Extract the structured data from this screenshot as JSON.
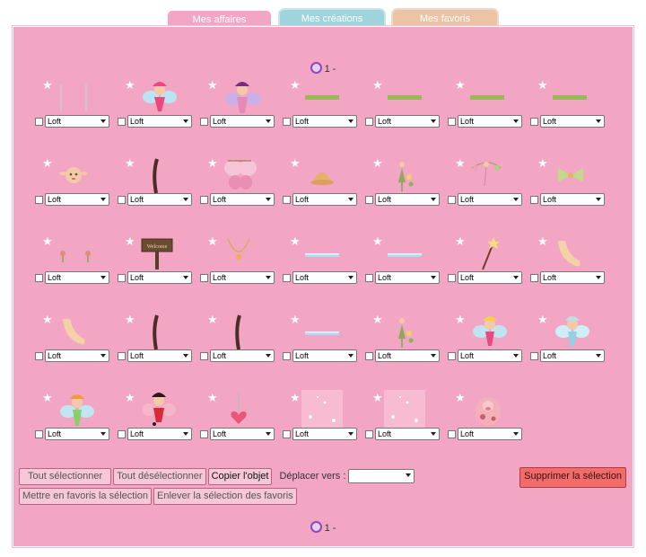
{
  "tabs": [
    "Mes affaires",
    "Mes créations",
    "Mes favoris"
  ],
  "pager": {
    "page_label": "1 -"
  },
  "location_default": "Loft",
  "items": [
    {
      "name": "silver-strands"
    },
    {
      "name": "pink-fairy"
    },
    {
      "name": "purple-fairy"
    },
    {
      "name": "green-bar"
    },
    {
      "name": "green-bar"
    },
    {
      "name": "green-bar"
    },
    {
      "name": "green-bar"
    },
    {
      "name": "doll-face"
    },
    {
      "name": "dark-braid"
    },
    {
      "name": "fairy-wings"
    },
    {
      "name": "hair-bun"
    },
    {
      "name": "flower-sprite"
    },
    {
      "name": "flower-bow"
    },
    {
      "name": "green-bow"
    },
    {
      "name": "earrings"
    },
    {
      "name": "welcome-sign"
    },
    {
      "name": "necklace"
    },
    {
      "name": "ice-strip"
    },
    {
      "name": "ice-strip"
    },
    {
      "name": "magic-wand"
    },
    {
      "name": "arm"
    },
    {
      "name": "arm"
    },
    {
      "name": "dark-braid"
    },
    {
      "name": "dark-braid"
    },
    {
      "name": "ice-strip"
    },
    {
      "name": "flower-sprite"
    },
    {
      "name": "yellow-fairy"
    },
    {
      "name": "blue-fairy"
    },
    {
      "name": "orange-fairy"
    },
    {
      "name": "red-fairy"
    },
    {
      "name": "heart-pendant"
    },
    {
      "name": "pink-sparkle"
    },
    {
      "name": "pink-sparkle"
    },
    {
      "name": "pink-pig"
    }
  ],
  "buttons": {
    "select_all": "Tout sélectionner",
    "deselect_all": "Tout désélectionner",
    "copy": "Copier l'objet",
    "move_to": "Déplacer vers :",
    "delete": "Supprimer la sélection",
    "fav_add": "Mettre en favoris la sélection",
    "fav_remove": "Enlever la sélection des favoris"
  },
  "colors": {
    "panel": "#f2a6c4",
    "tab_affaires": "#f2a6c4",
    "tab_creations": "#9fd4dd",
    "tab_favoris": "#ebc3a5",
    "delete": "#f26b6b"
  }
}
